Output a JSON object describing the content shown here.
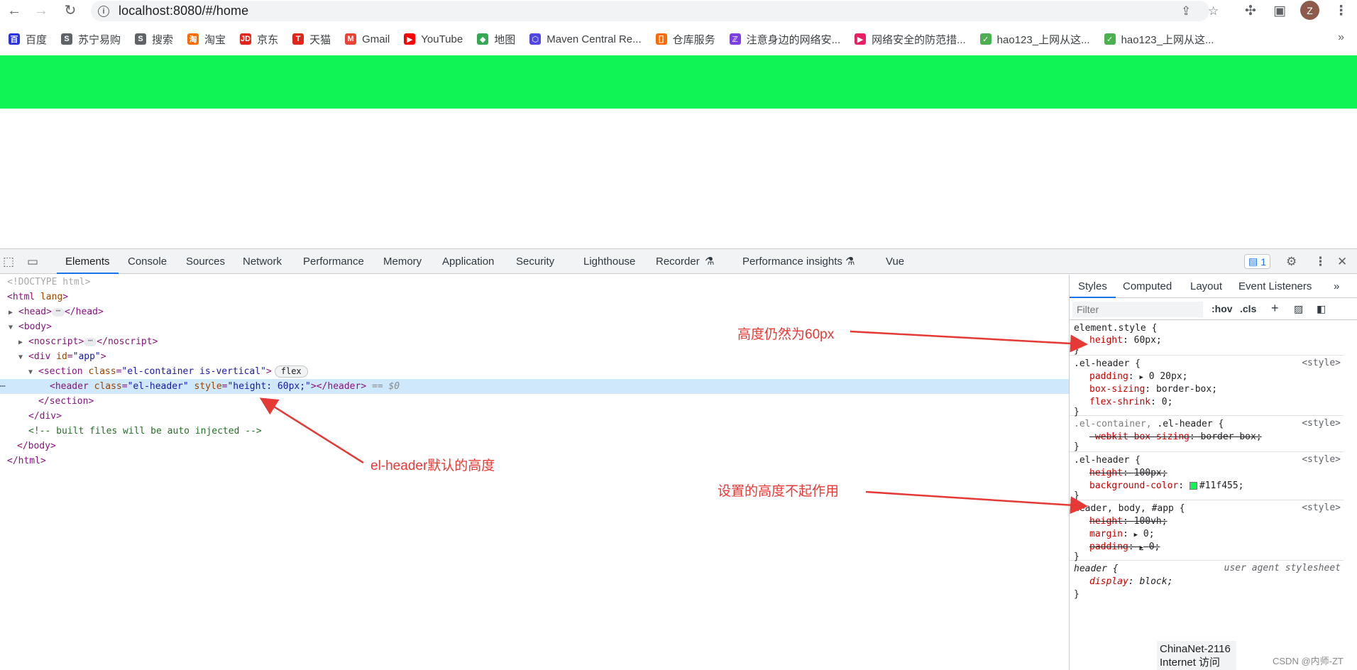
{
  "browser": {
    "url": "localhost:8080/#/home",
    "avatar_letter": "Z",
    "icons": {
      "back": "back-arrow-icon",
      "forward": "forward-arrow-icon",
      "reload": "reload-icon",
      "share": "share-icon",
      "star": "star-icon",
      "extensions": "puzzle-icon",
      "sidepanel": "sidepanel-icon",
      "menu": "kebab-menu-icon"
    }
  },
  "bookmarks": [
    {
      "label": "百度",
      "color": "#2932e1",
      "glyph": "百"
    },
    {
      "label": "苏宁易购",
      "color": "#5f6368",
      "glyph": "S"
    },
    {
      "label": "搜索",
      "color": "#5f6368",
      "glyph": "S"
    },
    {
      "label": "淘宝",
      "color": "#ff6a00",
      "glyph": "淘"
    },
    {
      "label": "京东",
      "color": "#e1251b",
      "glyph": "JD"
    },
    {
      "label": "天猫",
      "color": "#e1251b",
      "glyph": "T"
    },
    {
      "label": "Gmail",
      "color": "#ea4335",
      "glyph": "M"
    },
    {
      "label": "YouTube",
      "color": "#ff0000",
      "glyph": "▶"
    },
    {
      "label": "地图",
      "color": "#34a853",
      "glyph": "◆"
    },
    {
      "label": "Maven Central Re...",
      "color": "#4f46e5",
      "glyph": "⬡"
    },
    {
      "label": "仓库服务",
      "color": "#ff6a00",
      "glyph": "[]"
    },
    {
      "label": "注意身边的网络安...",
      "color": "#7b3fe4",
      "glyph": "ℤ"
    },
    {
      "label": "网络安全的防范措...",
      "color": "#e91e63",
      "glyph": "▶"
    },
    {
      "label": "hao123_上网从这...",
      "color": "#4caf50",
      "glyph": "✓"
    },
    {
      "label": "hao123_上网从这...",
      "color": "#4caf50",
      "glyph": "✓"
    }
  ],
  "bookmarks_more": "»",
  "page": {
    "header_color": "#11f455"
  },
  "devtools": {
    "tabs": [
      "Elements",
      "Console",
      "Sources",
      "Network",
      "Performance",
      "Memory",
      "Application",
      "Security",
      "Lighthouse",
      "Recorder",
      "Performance insights",
      "Vue"
    ],
    "issues_count": "1",
    "dom": {
      "doctype": "<!DOCTYPE html>",
      "html_open": "html",
      "html_attr": "lang",
      "head_tag": "head",
      "body_tag": "body",
      "noscript_tag": "noscript",
      "div_tag": "div",
      "div_attr": "id",
      "div_val": "\"app\"",
      "section_tag": "section",
      "section_attr": "class",
      "section_val": "\"el-container is-vertical\"",
      "flex_badge": "flex",
      "header_tag": "header",
      "header_attr1": "class",
      "header_val1": "\"el-header\"",
      "header_attr2": "style",
      "header_val2": "\"height: 60px;\"",
      "selected_marker": "== $0",
      "comment": "<!-- built files will be auto injected -->",
      "html_close": "</html>"
    },
    "styles_tabs": [
      "Styles",
      "Computed",
      "Layout",
      "Event Listeners"
    ],
    "filter_placeholder": "Filter",
    "hov": ":hov",
    "cls": ".cls",
    "rules": {
      "r1_selector": "element.style {",
      "r1_p1_name": "height",
      "r1_p1_val": "60px;",
      "r2_selector": ".el-header {",
      "r2_src": "<style>",
      "r2_p1_name": "padding",
      "r2_p1_val": "0 20px;",
      "r2_p2_name": "box-sizing",
      "r2_p2_val": "border-box;",
      "r2_p3_name": "flex-shrink",
      "r2_p3_val": "0;",
      "r3_selector_a": ".el-container,",
      "r3_selector_b": ".el-header {",
      "r3_src": "<style>",
      "r3_p1_name": "-webkit-box-sizing",
      "r3_p1_val": "border-box;",
      "r4_selector": ".el-header {",
      "r4_src": "<style>",
      "r4_p1_name": "height",
      "r4_p1_val": "100px;",
      "r4_p2_name": "background-color",
      "r4_p2_val": "#11f455;",
      "r5_selector": "header, body, #app {",
      "r5_src": "<style>",
      "r5_p1_name": "height",
      "r5_p1_val": "100vh;",
      "r5_p2_name": "margin",
      "r5_p2_val": "0;",
      "r5_p3_name": "padding",
      "r5_p3_val": "0;",
      "r6_selector": "header {",
      "r6_src": "user agent stylesheet",
      "r6_p1_name": "display",
      "r6_p1_val": "block;",
      "close": "}"
    }
  },
  "tooltip": {
    "line1": "ChinaNet-2116",
    "line2": "Internet 访问"
  },
  "watermark": "CSDN @内师-ZT",
  "annotations": {
    "a1": "高度仍然为60px",
    "a2": "el-header默认的高度",
    "a3": "设置的高度不起作用"
  }
}
